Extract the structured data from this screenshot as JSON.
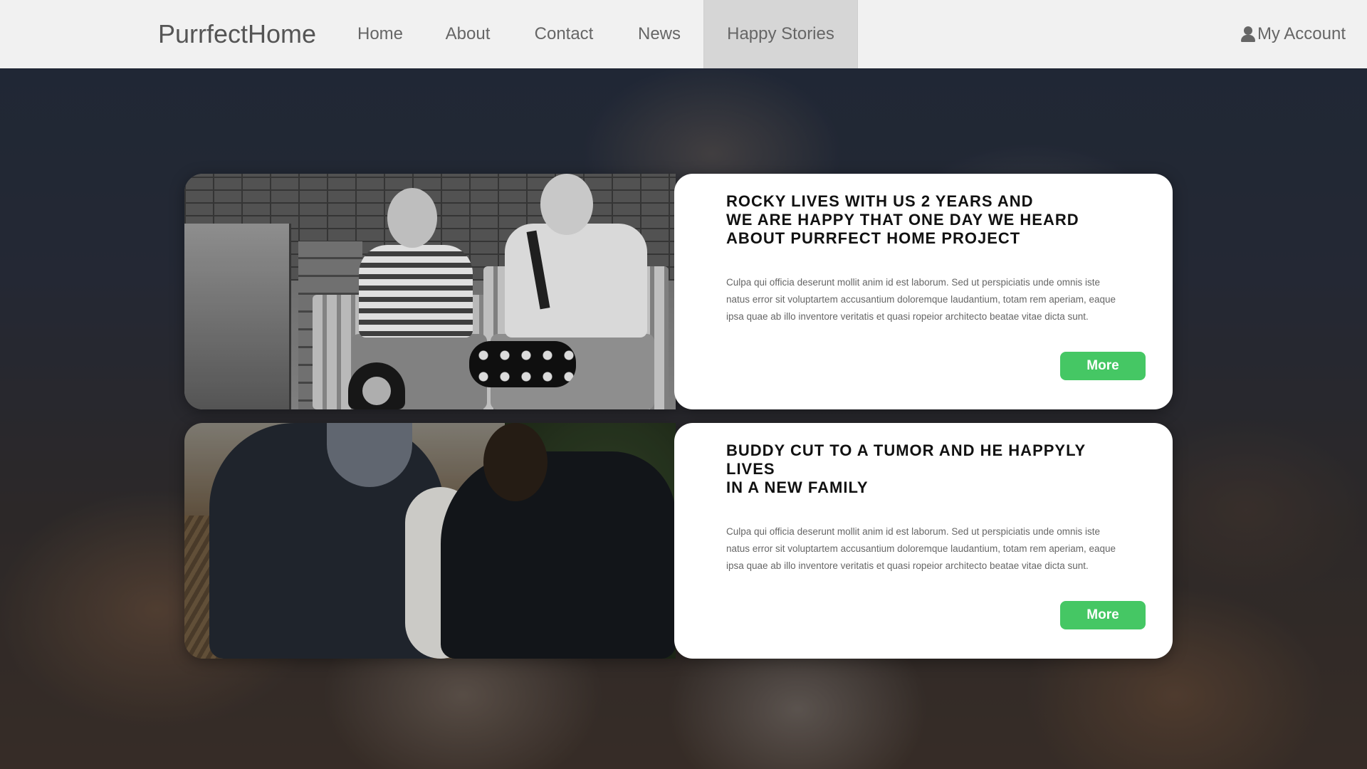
{
  "brand": "PurrfectHome",
  "nav": {
    "items": [
      "Home",
      "About",
      "Contact",
      "News",
      "Happy Stories"
    ],
    "active": "Happy Stories",
    "account_label": "My Account",
    "account_icon": "user-icon"
  },
  "colors": {
    "nav_bg": "#f1f1f1",
    "nav_active_bg": "#d6d6d6",
    "button": "#45c764",
    "card_bg": "#ffffff"
  },
  "stories": [
    {
      "title_lines": [
        "ROCKY LIVES WITH US 2 YEARS AND",
        "WE ARE HAPPY THAT ONE DAY WE HEARD",
        "ABOUT PURRFECT HOME PROJECT"
      ],
      "text_lines": [
        "Culpa qui officia deserunt mollit anim id est laborum. Sed ut perspiciatis unde omnis iste",
        "natus error sit voluptartem accusantium doloremque laudantium, totam rem aperiam, eaque",
        "ipsa quae ab illo inventore veritatis et quasi ropeior architecto beatae vitae dicta sunt."
      ],
      "button_label": "More"
    },
    {
      "title_lines": [
        "BUDDY CUT TO A TUMOR AND HE HAPPYLY LIVES",
        "IN A NEW FAMILY"
      ],
      "text_lines": [
        "Culpa qui officia deserunt mollit anim id est laborum. Sed ut perspiciatis unde omnis iste",
        "natus error sit voluptartem accusantium doloremque laudantium, totam rem aperiam, eaque",
        "ipsa quae ab illo inventore veritatis et quasi ropeior architecto beatae vitae dicta sunt."
      ],
      "button_label": "More"
    }
  ]
}
